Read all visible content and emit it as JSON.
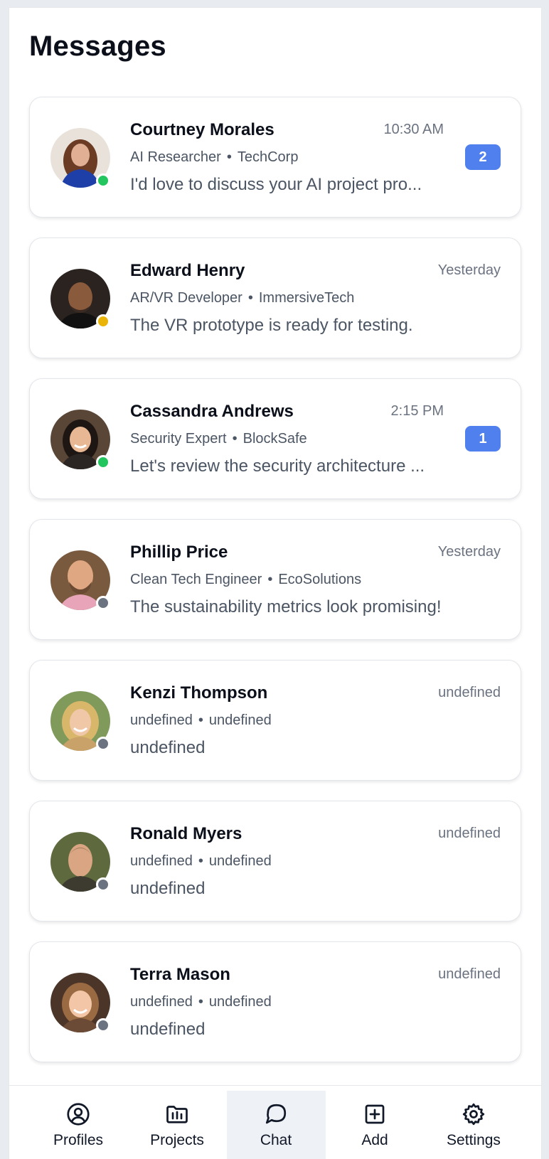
{
  "page": {
    "title": "Messages"
  },
  "colors": {
    "online": "#22c55e",
    "away": "#eab308",
    "offline": "#6b7280",
    "badge": "#4f80ee",
    "nav_active_bg": "#eef1f6"
  },
  "conversations": [
    {
      "name": "Courtney Morales",
      "time": "10:30 AM",
      "role": "AI Researcher",
      "company": "TechCorp",
      "preview": "I'd love to discuss your AI project pro...",
      "unread": "2",
      "status": "online"
    },
    {
      "name": "Edward Henry",
      "time": "Yesterday",
      "role": "AR/VR Developer",
      "company": "ImmersiveTech",
      "preview": "The VR prototype is ready for testing.",
      "unread": "",
      "status": "away"
    },
    {
      "name": "Cassandra Andrews",
      "time": "2:15 PM",
      "role": "Security Expert",
      "company": "BlockSafe",
      "preview": "Let's review the security architecture ...",
      "unread": "1",
      "status": "online"
    },
    {
      "name": "Phillip Price",
      "time": "Yesterday",
      "role": "Clean Tech Engineer",
      "company": "EcoSolutions",
      "preview": "The sustainability metrics look promising!",
      "unread": "",
      "status": "offline"
    },
    {
      "name": "Kenzi Thompson",
      "time": "undefined",
      "role": "undefined",
      "company": "undefined",
      "preview": "undefined",
      "unread": "",
      "status": "offline"
    },
    {
      "name": "Ronald Myers",
      "time": "undefined",
      "role": "undefined",
      "company": "undefined",
      "preview": "undefined",
      "unread": "",
      "status": "offline"
    },
    {
      "name": "Terra Mason",
      "time": "undefined",
      "role": "undefined",
      "company": "undefined",
      "preview": "undefined",
      "unread": "",
      "status": "offline"
    }
  ],
  "separator": "•",
  "nav": {
    "items": [
      {
        "label": "Profiles",
        "icon": "user-circle-icon"
      },
      {
        "label": "Projects",
        "icon": "folder-chart-icon"
      },
      {
        "label": "Chat",
        "icon": "chat-bubble-icon",
        "active": true
      },
      {
        "label": "Add",
        "icon": "plus-square-icon"
      },
      {
        "label": "Settings",
        "icon": "gear-icon"
      }
    ]
  }
}
